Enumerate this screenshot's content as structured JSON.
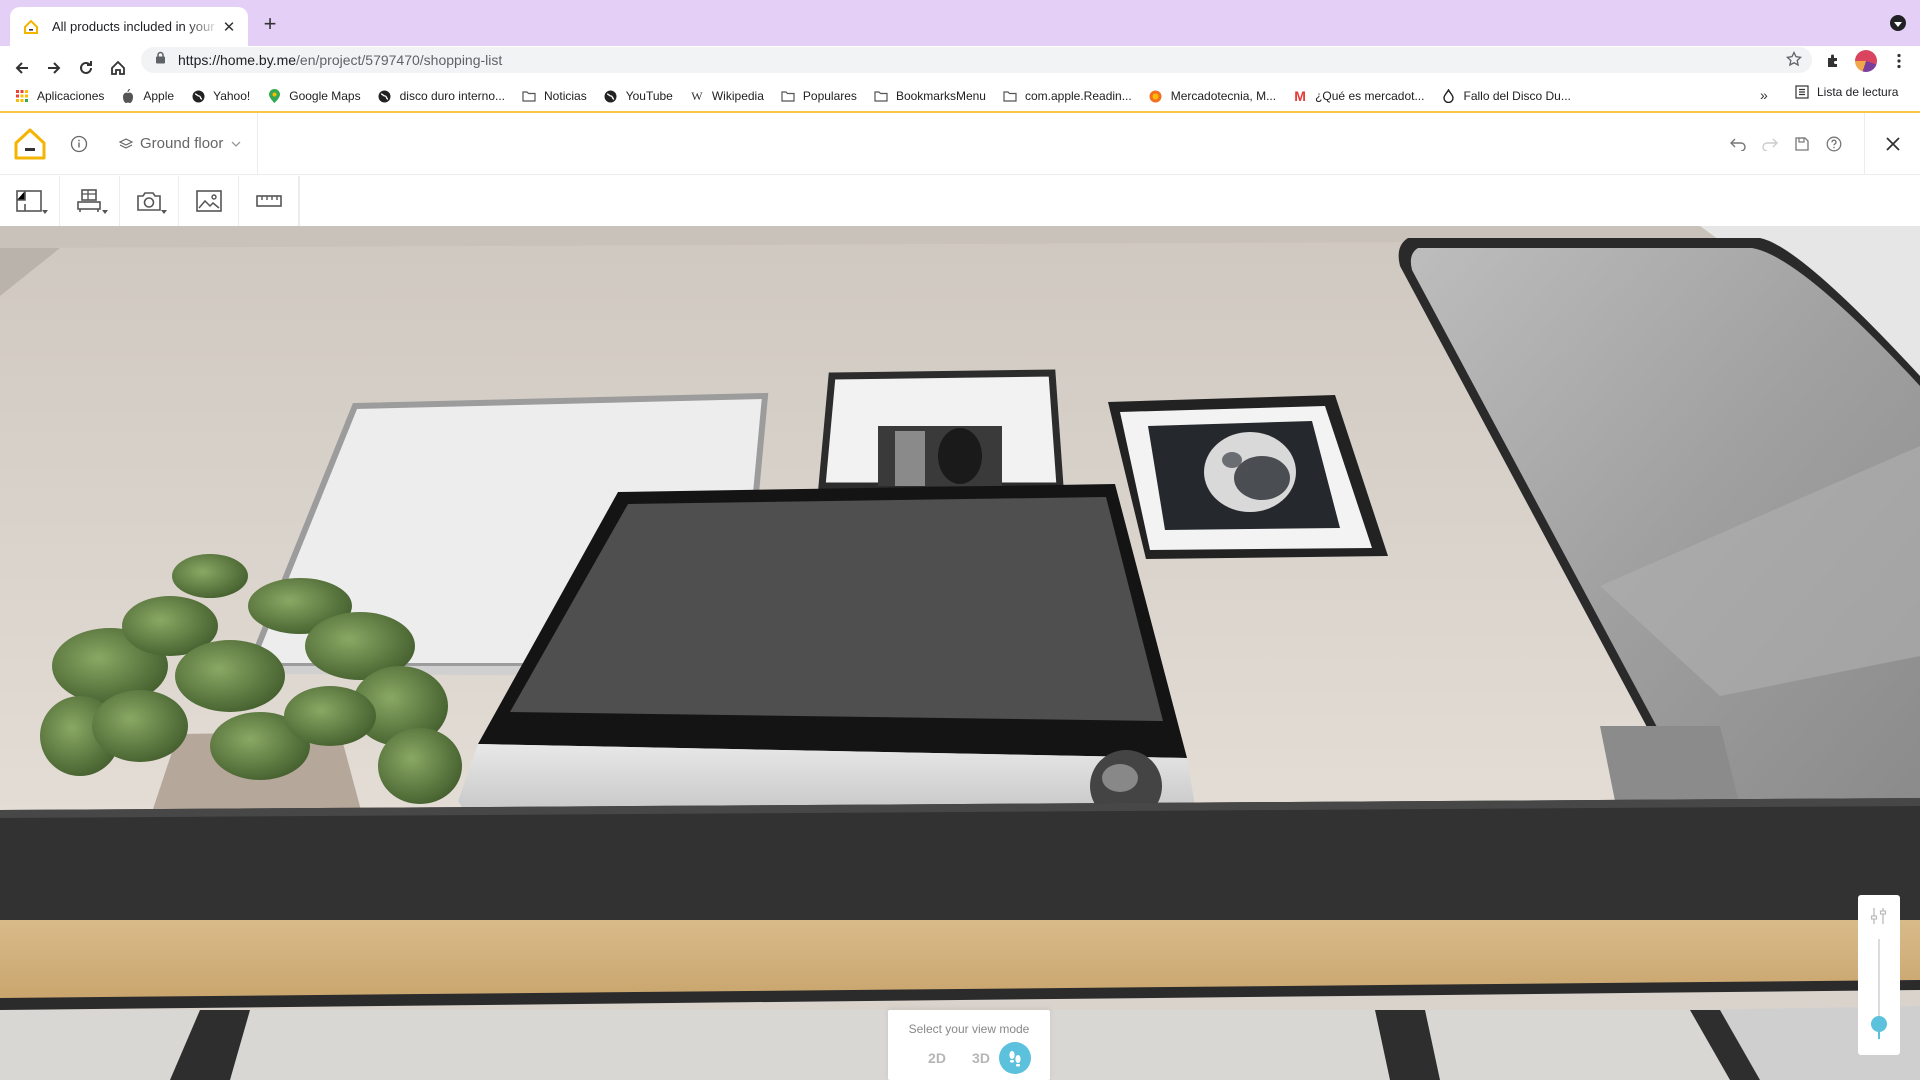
{
  "browser": {
    "tab_title": "All products included in your project",
    "url_host": "https://home.by.me",
    "url_path": "/en/project/5797470/shopping-list",
    "bookmarks": [
      {
        "label": "Aplicaciones",
        "icon": "apps-grid-icon"
      },
      {
        "label": "Apple",
        "icon": "apple-icon"
      },
      {
        "label": "Yahoo!",
        "icon": "globe-icon"
      },
      {
        "label": "Google Maps",
        "icon": "map-pin-icon"
      },
      {
        "label": "disco duro interno...",
        "icon": "globe-icon"
      },
      {
        "label": "Noticias",
        "icon": "folder-icon"
      },
      {
        "label": "YouTube",
        "icon": "globe-icon"
      },
      {
        "label": "Wikipedia",
        "icon": "wikipedia-icon"
      },
      {
        "label": "Populares",
        "icon": "folder-icon"
      },
      {
        "label": "BookmarksMenu",
        "icon": "folder-icon"
      },
      {
        "label": "com.apple.Readin...",
        "icon": "folder-icon"
      },
      {
        "label": "Mercadotecnia, M...",
        "icon": "orange-circle-icon"
      },
      {
        "label": "¿Qué es mercadot...",
        "icon": "m-logo-icon"
      },
      {
        "label": "Fallo del Disco Du...",
        "icon": "drop-icon"
      }
    ],
    "more_label": "»",
    "reading_list_label": "Lista de lectura"
  },
  "app": {
    "floor_label": "Ground floor",
    "accent_color": "#f7c844",
    "active_color": "#5bc1dc"
  },
  "view_mode": {
    "title": "Select your view mode",
    "opt_2d": "2D",
    "opt_3d": "3D",
    "active": "walkthrough"
  },
  "zoom": {
    "level": 0.15
  }
}
